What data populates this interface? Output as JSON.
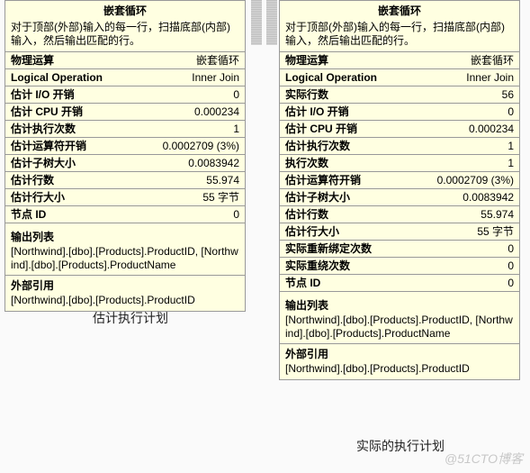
{
  "left": {
    "title": "嵌套循环",
    "desc": "对于顶部(外部)输入的每一行，扫描底部(内部)输入，然后输出匹配的行。",
    "rows": [
      {
        "k": "物理运算",
        "v": "嵌套循环"
      },
      {
        "k": "Logical Operation",
        "v": "Inner Join"
      },
      {
        "k": "估计 I/O 开销",
        "v": "0"
      },
      {
        "k": "估计 CPU 开销",
        "v": "0.000234"
      },
      {
        "k": "估计执行次数",
        "v": "1"
      },
      {
        "k": "估计运算符开销",
        "v": "0.0002709 (3%)"
      },
      {
        "k": "估计子树大小",
        "v": "0.0083942"
      },
      {
        "k": "估计行数",
        "v": "55.974"
      },
      {
        "k": "估计行大小",
        "v": "55 字节"
      },
      {
        "k": "节点 ID",
        "v": "0"
      }
    ],
    "output_title": "输出列表",
    "output_text": "[Northwind].[dbo].[Products].ProductID, [Northwind].[dbo].[Products].ProductName",
    "ref_title": "外部引用",
    "ref_text": "[Northwind].[dbo].[Products].ProductID",
    "caption": "估计执行计划"
  },
  "right": {
    "title": "嵌套循环",
    "desc": "对于顶部(外部)输入的每一行，扫描底部(内部)输入，然后输出匹配的行。",
    "rows": [
      {
        "k": "物理运算",
        "v": "嵌套循环"
      },
      {
        "k": "Logical Operation",
        "v": "Inner Join"
      },
      {
        "k": "实际行数",
        "v": "56"
      },
      {
        "k": "估计 I/O 开销",
        "v": "0"
      },
      {
        "k": "估计 CPU 开销",
        "v": "0.000234"
      },
      {
        "k": "估计执行次数",
        "v": "1"
      },
      {
        "k": "执行次数",
        "v": "1"
      },
      {
        "k": "估计运算符开销",
        "v": "0.0002709 (3%)"
      },
      {
        "k": "估计子树大小",
        "v": "0.0083942"
      },
      {
        "k": "估计行数",
        "v": "55.974"
      },
      {
        "k": "估计行大小",
        "v": "55 字节"
      },
      {
        "k": "实际重新绑定次数",
        "v": "0"
      },
      {
        "k": "实际重绕次数",
        "v": "0"
      },
      {
        "k": "节点 ID",
        "v": "0"
      }
    ],
    "output_title": "输出列表",
    "output_text": "[Northwind].[dbo].[Products].ProductID, [Northwind].[dbo].[Products].ProductName",
    "ref_title": "外部引用",
    "ref_text": "[Northwind].[dbo].[Products].ProductID",
    "caption": "实际的执行计划"
  },
  "watermark": "@51CTO博客"
}
